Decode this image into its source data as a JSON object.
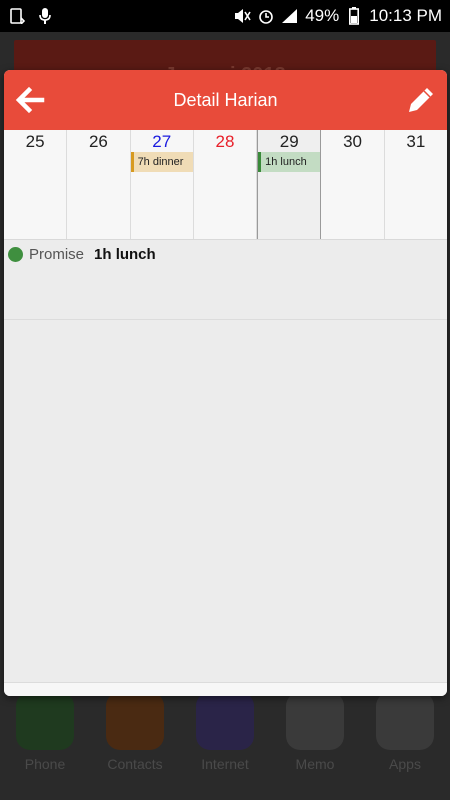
{
  "status_bar": {
    "battery": "49%",
    "time": "10:13 PM"
  },
  "background_app": {
    "header_title": "Januari 2018",
    "dock": [
      {
        "label": "Phone"
      },
      {
        "label": "Contacts"
      },
      {
        "label": "Internet"
      },
      {
        "label": "Memo"
      },
      {
        "label": "Apps"
      }
    ]
  },
  "dialog": {
    "title": "Detail Harian",
    "days": [
      {
        "num": "25",
        "event": ""
      },
      {
        "num": "26",
        "event": ""
      },
      {
        "num": "27",
        "event": "7h dinner"
      },
      {
        "num": "28",
        "event": ""
      },
      {
        "num": "29",
        "event": "1h lunch"
      },
      {
        "num": "30",
        "event": ""
      },
      {
        "num": "31",
        "event": ""
      }
    ],
    "list": [
      {
        "category": "Promise",
        "title": "1h lunch"
      }
    ],
    "colors": {
      "header": "#e84b3a",
      "promise_dot": "#3f8f3f"
    }
  }
}
